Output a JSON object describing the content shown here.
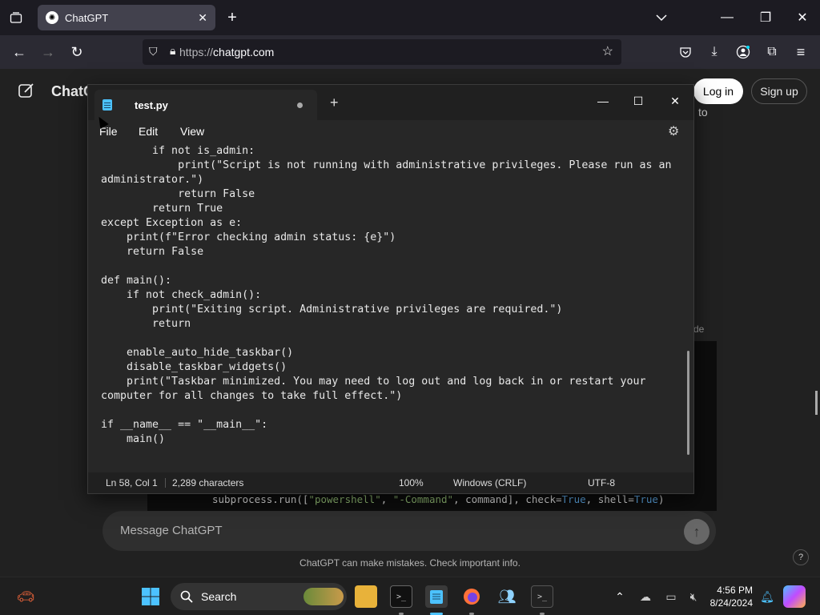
{
  "browser": {
    "tab_title": "ChatGPT",
    "url_scheme": "https://",
    "url_host": "chatgpt.com"
  },
  "chatgpt": {
    "brand": "ChatG",
    "login_label": "Log in",
    "signup_label": "Sign up",
    "behind_text_to": "to",
    "behind_text_de": "de",
    "message_placeholder": "Message ChatGPT",
    "disclaimer": "ChatGPT can make mistakes. Check important info.",
    "help_label": "?",
    "code_behind": {
      "prefix": "subprocess.run([",
      "arg1": "\"powershell\"",
      "comma1": ", ",
      "arg2": "\"-Command\"",
      "middle": ", command], check=",
      "true1": "True",
      "sep2": ", shell=",
      "true2": "True",
      "suffix": ")"
    }
  },
  "notepad": {
    "tab_filename": "test.py",
    "menu": {
      "file": "File",
      "edit": "Edit",
      "view": "View"
    },
    "code_lines": [
      "    if not is_admin:",
      "        print(\"Script is not running with administrative privileges. Please run as an",
      "administrator.\")",
      "        return False",
      "    return True",
      "except Exception as e:",
      "    print(f\"Error checking admin status: {e}\")",
      "    return False",
      "",
      "def main():",
      "    if not check_admin():",
      "        print(\"Exiting script. Administrative privileges are required.\")",
      "        return",
      "",
      "    enable_auto_hide_taskbar()",
      "    disable_taskbar_widgets()",
      "    print(\"Taskbar minimized. You may need to log out and log back in or restart your",
      "computer for all changes to take full effect.\")",
      "",
      "if __name__ == \"__main__\":",
      "    main()"
    ],
    "status": {
      "position": "Ln 58, Col 1",
      "characters": "2,289 characters",
      "zoom": "100%",
      "line_ending": "Windows (CRLF)",
      "encoding": "UTF-8"
    }
  },
  "taskbar": {
    "search_label": "Search",
    "time": "4:56 PM",
    "date": "8/24/2024"
  }
}
